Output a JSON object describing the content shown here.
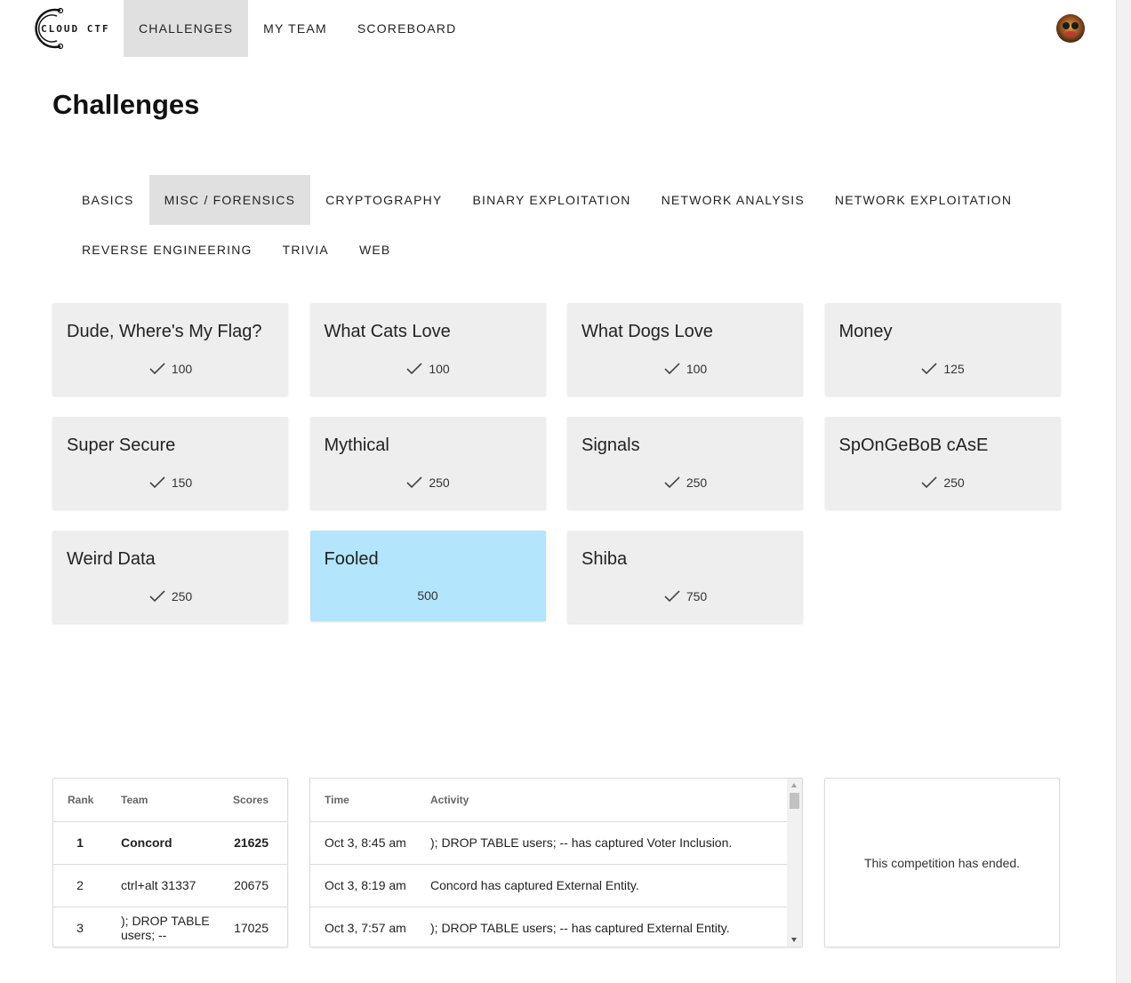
{
  "header": {
    "logo_text": "CLOUD CTF",
    "nav": [
      {
        "label": "CHALLENGES",
        "active": true
      },
      {
        "label": "MY TEAM",
        "active": false
      },
      {
        "label": "SCOREBOARD",
        "active": false
      }
    ]
  },
  "page": {
    "title": "Challenges"
  },
  "categories": [
    {
      "label": "BASICS",
      "active": false
    },
    {
      "label": "MISC / FORENSICS",
      "active": true
    },
    {
      "label": "CRYPTOGRAPHY",
      "active": false
    },
    {
      "label": "BINARY EXPLOITATION",
      "active": false
    },
    {
      "label": "NETWORK ANALYSIS",
      "active": false
    },
    {
      "label": "NETWORK EXPLOITATION",
      "active": false
    },
    {
      "label": "REVERSE ENGINEERING",
      "active": false
    },
    {
      "label": "TRIVIA",
      "active": false
    },
    {
      "label": "WEB",
      "active": false
    }
  ],
  "challenges": [
    {
      "title": "Dude, Where's My Flag?",
      "points": "100",
      "solved": true
    },
    {
      "title": "What Cats Love",
      "points": "100",
      "solved": true
    },
    {
      "title": "What Dogs Love",
      "points": "100",
      "solved": true
    },
    {
      "title": "Money",
      "points": "125",
      "solved": true
    },
    {
      "title": "Super Secure",
      "points": "150",
      "solved": true
    },
    {
      "title": "Mythical",
      "points": "250",
      "solved": true
    },
    {
      "title": "Signals",
      "points": "250",
      "solved": true
    },
    {
      "title": "SpOnGeBoB cAsE",
      "points": "250",
      "solved": true
    },
    {
      "title": "Weird Data",
      "points": "250",
      "solved": true
    },
    {
      "title": "Fooled",
      "points": "500",
      "solved": false
    },
    {
      "title": "Shiba",
      "points": "750",
      "solved": true
    }
  ],
  "leaderboard": {
    "headers": {
      "rank": "Rank",
      "team": "Team",
      "scores": "Scores"
    },
    "rows": [
      {
        "rank": "1",
        "team": "Concord",
        "score": "21625"
      },
      {
        "rank": "2",
        "team": "ctrl+alt 31337",
        "score": "20675"
      },
      {
        "rank": "3",
        "team": "); DROP TABLE users; --",
        "score": "17025"
      }
    ]
  },
  "activity": {
    "headers": {
      "time": "Time",
      "activity": "Activity"
    },
    "rows": [
      {
        "time": "Oct 3, 8:45 am",
        "text": "); DROP TABLE users; -- has captured Voter Inclusion."
      },
      {
        "time": "Oct 3, 8:19 am",
        "text": "Concord has captured External Entity."
      },
      {
        "time": "Oct 3, 7:57 am",
        "text": "); DROP TABLE users; -- has captured External Entity."
      }
    ]
  },
  "status": {
    "message": "This competition has ended."
  },
  "colors": {
    "card_bg": "#eeeeee",
    "unsolved_bg": "#b3e5fc",
    "active_tab": "#e0e0e0"
  },
  "icons": {
    "solved": "check-icon"
  }
}
